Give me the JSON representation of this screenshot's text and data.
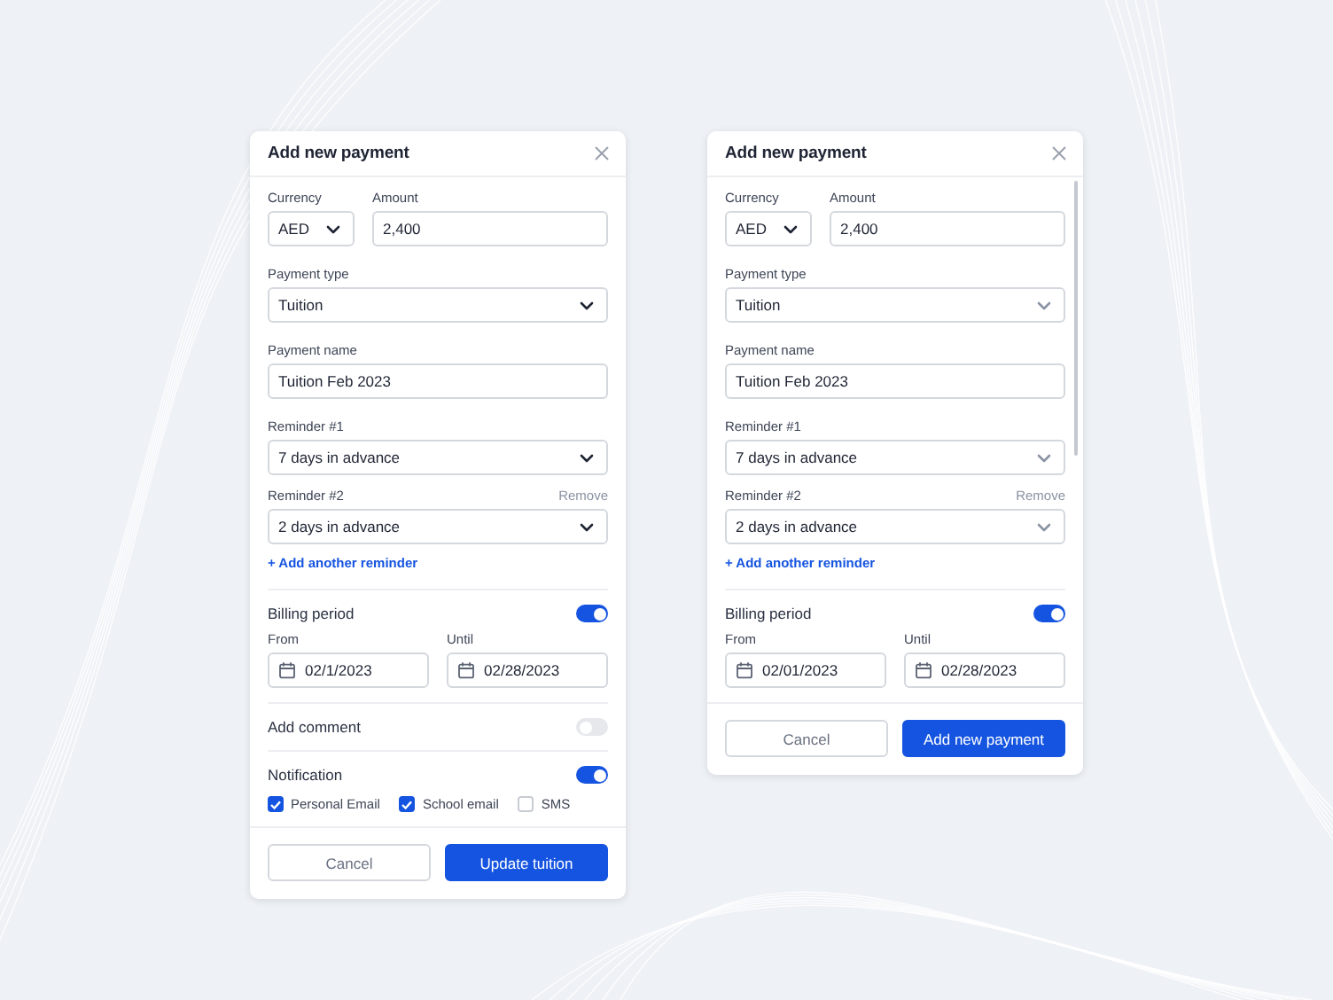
{
  "dialogs": [
    {
      "kind": "full",
      "title": "Add new payment",
      "currency": {
        "label": "Currency",
        "value": "AED"
      },
      "amount": {
        "label": "Amount",
        "value": "2,400"
      },
      "payment_type": {
        "label": "Payment type",
        "value": "Tuition"
      },
      "payment_name": {
        "label": "Payment name",
        "value": "Tuition Feb 2023"
      },
      "reminders": [
        {
          "label": "Reminder #1",
          "value": "7 days in advance"
        },
        {
          "label": "Reminder #2",
          "value": "2 days in advance",
          "action": "Remove"
        }
      ],
      "add_reminder": "+ Add another reminder",
      "billing": {
        "label": "Billing period",
        "on": true,
        "from": {
          "label": "From",
          "value": "02/1/2023"
        },
        "until": {
          "label": "Until",
          "value": "02/28/2023"
        }
      },
      "comment": {
        "label": "Add comment",
        "on": false
      },
      "notification": {
        "label": "Notification",
        "on": true,
        "options": [
          {
            "label": "Personal Email",
            "checked": true
          },
          {
            "label": "School email",
            "checked": true
          },
          {
            "label": "SMS",
            "checked": false
          }
        ]
      },
      "buttons": {
        "cancel": "Cancel",
        "primary": "Update tuition"
      }
    },
    {
      "kind": "scrolling",
      "title": "Add new payment",
      "currency": {
        "label": "Currency",
        "value": "AED"
      },
      "amount": {
        "label": "Amount",
        "value": "2,400"
      },
      "payment_type": {
        "label": "Payment type",
        "value": "Tuition"
      },
      "payment_name": {
        "label": "Payment name",
        "value": "Tuition Feb 2023"
      },
      "reminders": [
        {
          "label": "Reminder #1",
          "value": "7 days in advance"
        },
        {
          "label": "Reminder #2",
          "value": "2 days in advance",
          "action": "Remove"
        }
      ],
      "add_reminder": "+ Add another reminder",
      "billing": {
        "label": "Billing period",
        "on": true,
        "from": {
          "label": "From",
          "value": "02/01/2023"
        },
        "until": {
          "label": "Until",
          "value": "02/28/2023"
        }
      },
      "buttons": {
        "cancel": "Cancel",
        "primary": "Add new payment"
      }
    }
  ]
}
